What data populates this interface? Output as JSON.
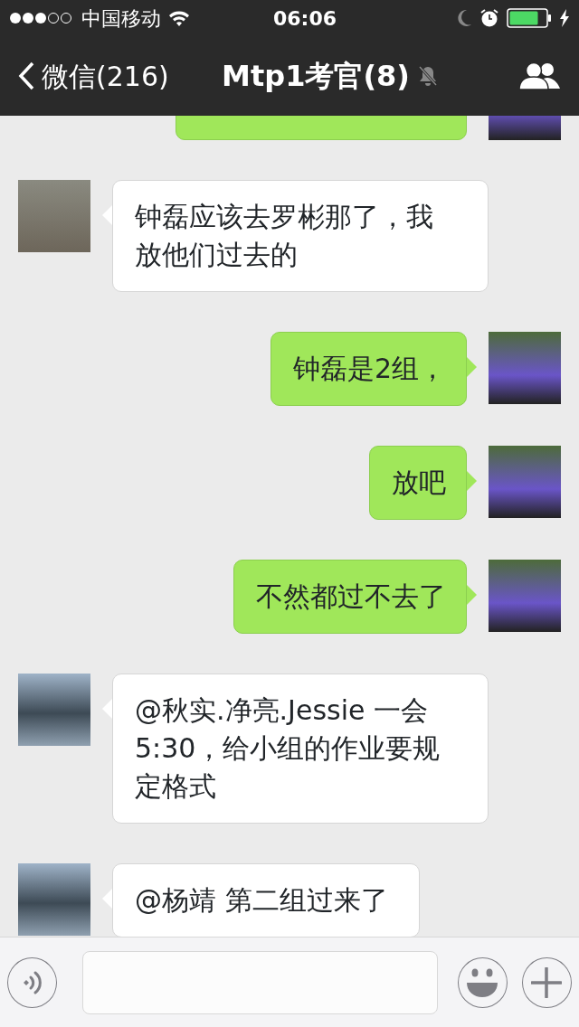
{
  "status_bar": {
    "carrier": "中国移动",
    "time": "06:06"
  },
  "nav": {
    "back_label": "微信(216)",
    "title": "Mtp1考官(8)",
    "muted": true
  },
  "messages": [
    {
      "kind": "outgoing"
    },
    {
      "kind": "incoming",
      "text": "钟磊应该去罗彬那了，我放他们过去的"
    },
    {
      "kind": "outgoing",
      "text": "钟磊是2组，"
    },
    {
      "kind": "outgoing",
      "text": "放吧"
    },
    {
      "kind": "outgoing",
      "text": "不然都过不去了"
    },
    {
      "kind": "incoming",
      "text": "@秋实.净亮.Jessie 一会5:30，给小组的作业要规定格式"
    },
    {
      "kind": "incoming",
      "text": "@杨靖 第二组过来了"
    }
  ]
}
